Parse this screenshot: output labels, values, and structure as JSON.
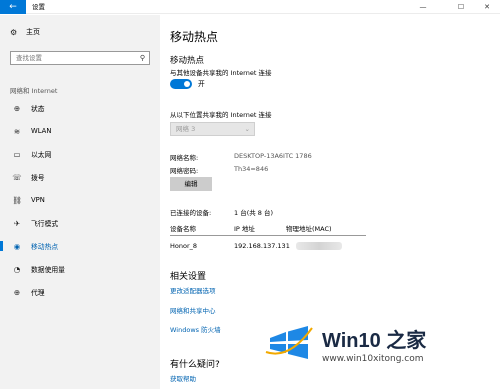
{
  "window": {
    "title": "设置",
    "back_glyph": "←",
    "minimize_glyph": "—",
    "maximize_glyph": "☐",
    "close_glyph": "✕"
  },
  "sidebar": {
    "home": {
      "label": "主页",
      "icon": "gear-icon"
    },
    "search_placeholder": "查找设置",
    "section_label": "网络和 Internet",
    "items": [
      {
        "label": "状态",
        "icon": "globe-icon",
        "glyph": "⊕",
        "active": false
      },
      {
        "label": "WLAN",
        "icon": "wifi-icon",
        "glyph": "≋",
        "active": false
      },
      {
        "label": "以太网",
        "icon": "ethernet-icon",
        "glyph": "▭",
        "active": false
      },
      {
        "label": "拨号",
        "icon": "phone-icon",
        "glyph": "☏",
        "active": false
      },
      {
        "label": "VPN",
        "icon": "vpn-icon",
        "glyph": "⛓",
        "active": false
      },
      {
        "label": "飞行模式",
        "icon": "airplane-icon",
        "glyph": "✈",
        "active": false
      },
      {
        "label": "移动热点",
        "icon": "hotspot-icon",
        "glyph": "◉",
        "active": true
      },
      {
        "label": "数据使用量",
        "icon": "data-usage-icon",
        "glyph": "◔",
        "active": false
      },
      {
        "label": "代理",
        "icon": "proxy-icon",
        "glyph": "⊕",
        "active": false
      }
    ]
  },
  "main": {
    "page_title": "移动热点",
    "subheading": "移动热点",
    "share_description": "与其他设备共享我的 Internet 连接",
    "toggle_state": "开",
    "share_from_label": "从以下位置共享我的 Internet 连接",
    "share_from_value": "网络 3",
    "network_name_label": "网络名称:",
    "network_name_value": "DESKTOP-13A6ITC 1786",
    "network_password_label": "网络密码:",
    "network_password_value": "Th34=846",
    "edit_button": "编辑",
    "connected_devices_label": "已连接的设备:",
    "connected_devices_value": "1 台(共 8 台)",
    "table": {
      "headers": [
        "设备名称",
        "IP 地址",
        "物理地址(MAC)"
      ],
      "rows": [
        {
          "device": "Honor_8",
          "ip": "192.168.137.131"
        }
      ]
    },
    "related_title": "相关设置",
    "related_links": [
      "更改适配器选项",
      "网络和共享中心",
      "Windows 防火墙"
    ],
    "question_title": "有什么疑问?",
    "help_link": "获取帮助"
  },
  "watermark": {
    "title": "Win10 之家",
    "url": "www.win10xitong.com"
  },
  "colors": {
    "accent": "#0078d7",
    "link": "#0063b1",
    "sidebar_bg": "#f2f2f2"
  }
}
